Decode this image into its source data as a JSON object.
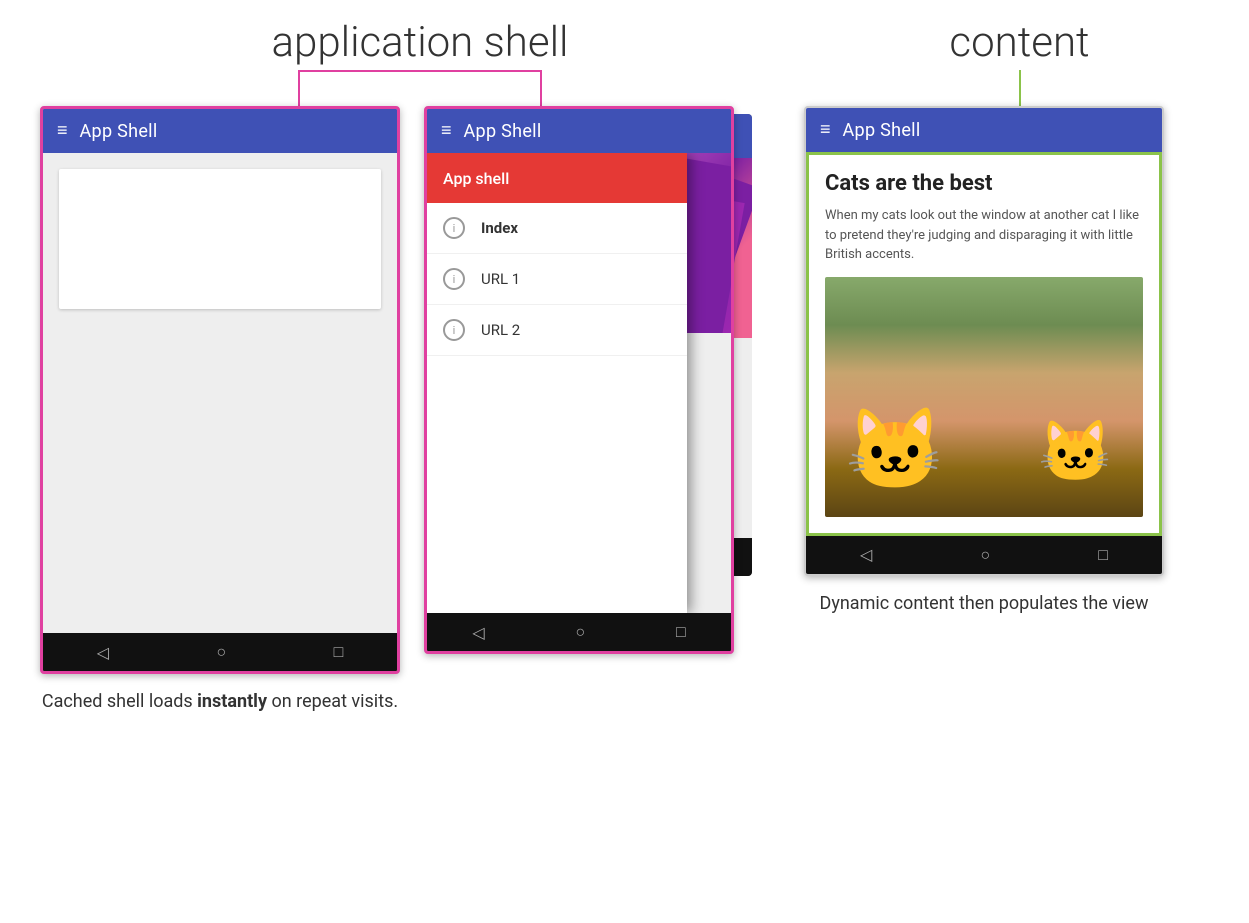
{
  "labels": {
    "app_shell_label": "application shell",
    "content_label": "content",
    "left_phone_title": "App Shell",
    "middle_phone_title": "App Shell",
    "right_phone_title": "App Shell",
    "drawer_header": "App shell",
    "drawer_item_1": "Index",
    "drawer_item_2": "URL 1",
    "drawer_item_3": "URL 2",
    "card_title": "Cats are the best",
    "card_text": "When my cats look out the window at another cat I like to pretend they're judging and disparaging it with little British accents.",
    "caption_left": "Cached shell loads instantly on repeat visits.",
    "caption_right": "Dynamic content then populates the view",
    "caption_instantly": "instantly"
  },
  "colors": {
    "app_bar": "#3f51b5",
    "pink_border": "#e040a0",
    "green_border": "#8bc34a",
    "drawer_header_bg": "#e53935",
    "nav_bar": "#111111"
  },
  "nav": {
    "back_icon": "◁",
    "home_icon": "○",
    "recents_icon": "□"
  }
}
